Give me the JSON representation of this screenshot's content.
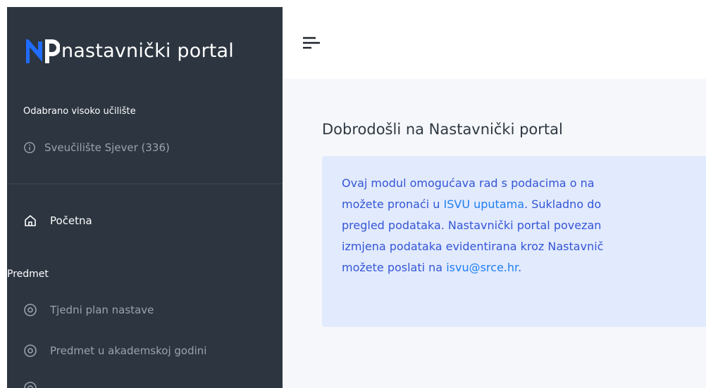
{
  "logo": {
    "mark": "NP",
    "text": "nastavnički portal"
  },
  "sidebar": {
    "institution_label": "Odabrano visoko učilište",
    "institution_value": "Sveučilište Sjever (336)",
    "home_label": "Početna",
    "section_label": "Predmet",
    "items": [
      {
        "label": "Tjedni plan nastave",
        "icon": "target-icon"
      },
      {
        "label": "Predmet u akademskoj godini",
        "icon": "target-icon"
      }
    ]
  },
  "header": {
    "menu_icon": "menu-icon"
  },
  "main": {
    "title": "Dobrodošli na Nastavnički portal",
    "alert": {
      "line1": "Ovaj modul omogućava rad s podacima o na",
      "line2_a": "možete pronaći u ",
      "line2_link": "ISVU uputama",
      "line2_b": ". Sukladno do",
      "line3": "pregled podataka. Nastavnički portal povezan",
      "line4": "izmjena podataka evidentirana kroz Nastavnič",
      "line5_a": "možete poslati na ",
      "line5_link": "isvu@srce.hr",
      "line5_b": "."
    }
  },
  "colors": {
    "sidebar_bg": "#2c3540",
    "logo_blue": "#1f6cff",
    "content_bg": "#f5f7fb",
    "alert_bg": "#e2eafd",
    "alert_text": "#3356d6",
    "link": "#1e7ff2"
  }
}
